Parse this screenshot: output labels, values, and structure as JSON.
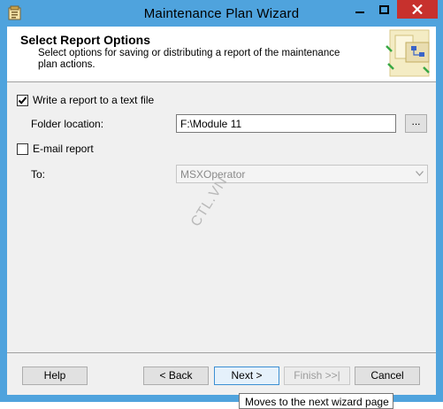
{
  "window": {
    "title": "Maintenance Plan Wizard"
  },
  "header": {
    "title": "Select Report Options",
    "description": "Select options for saving or distributing a report of the maintenance plan actions."
  },
  "form": {
    "write_report": {
      "label": "Write a report to a text file",
      "checked": true
    },
    "folder_location": {
      "label": "Folder location:",
      "value": "F:\\Module 11",
      "browse_label": "..."
    },
    "email_report": {
      "label": "E-mail report",
      "checked": false
    },
    "to": {
      "label": "To:",
      "value": "MSXOperator",
      "disabled": true
    }
  },
  "watermark": "CTL.VN",
  "footer": {
    "help": "Help",
    "back": "< Back",
    "next": "Next >",
    "finish": "Finish >>|",
    "cancel": "Cancel"
  },
  "tooltip": "Moves to the next wizard page",
  "colors": {
    "titlebar": "#4fa3dd",
    "close_button": "#c7312d",
    "dialog_bg": "#f0f0f0"
  },
  "icons": [
    "app-icon",
    "minimize-icon",
    "maximize-icon",
    "close-icon",
    "checkmark-icon",
    "dropdown-arrow-icon",
    "wizard-graphic-icon"
  ]
}
